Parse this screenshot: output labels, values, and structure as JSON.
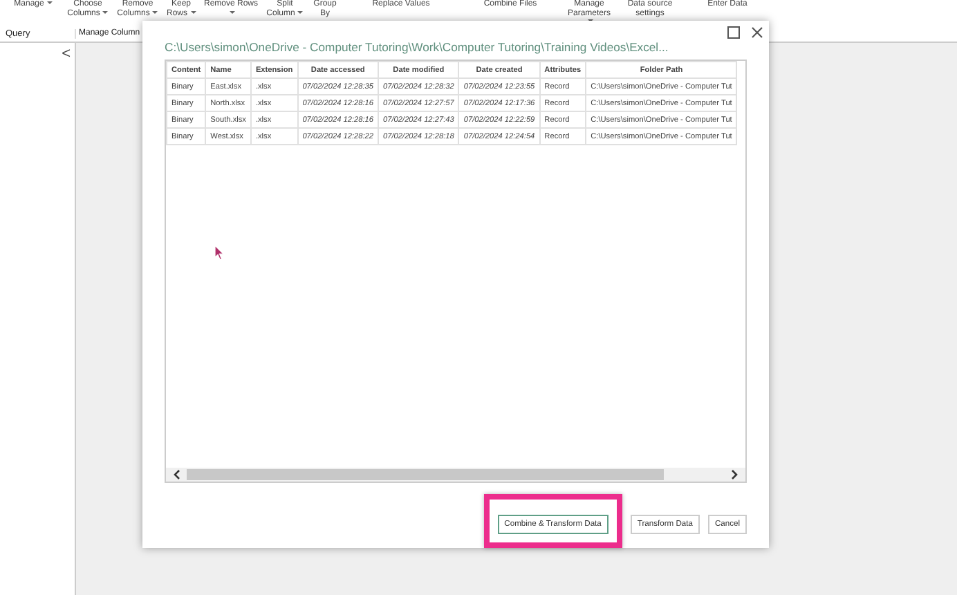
{
  "ribbon": {
    "items": [
      {
        "label": "Manage",
        "dropdown": true
      },
      {
        "label": "Choose Columns",
        "dropdown": true
      },
      {
        "label": "Remove Columns",
        "dropdown": true
      },
      {
        "label": "Keep Rows",
        "dropdown": true
      },
      {
        "label": "Remove Rows",
        "dropdown": true
      },
      {
        "label": "Split Column",
        "dropdown": true
      },
      {
        "label": "Group By",
        "dropdown": false
      },
      {
        "label": "Replace Values",
        "dropdown": false
      },
      {
        "label": "Combine Files",
        "dropdown": false
      },
      {
        "label": "Manage Parameters",
        "dropdown": true
      },
      {
        "label": "Data source settings",
        "dropdown": false
      },
      {
        "label": "Enter Data",
        "dropdown": false
      }
    ],
    "groups": [
      "Query",
      "Manage Column"
    ]
  },
  "collapse_button": "<",
  "dialog": {
    "title": "C:\\Users\\simon\\OneDrive - Computer Tutoring\\Work\\Computer Tutoring\\Training Videos\\Excel...",
    "table": {
      "columns": [
        "Content",
        "Name",
        "Extension",
        "Date accessed",
        "Date modified",
        "Date created",
        "Attributes",
        "Folder Path"
      ],
      "rows": [
        [
          "Binary",
          "East.xlsx",
          ".xlsx",
          "07/02/2024 12:28:35",
          "07/02/2024 12:28:32",
          "07/02/2024 12:23:55",
          "Record",
          "C:\\Users\\simon\\OneDrive - Computer Tut"
        ],
        [
          "Binary",
          "North.xlsx",
          ".xlsx",
          "07/02/2024 12:28:16",
          "07/02/2024 12:27:57",
          "07/02/2024 12:17:36",
          "Record",
          "C:\\Users\\simon\\OneDrive - Computer Tut"
        ],
        [
          "Binary",
          "South.xlsx",
          ".xlsx",
          "07/02/2024 12:28:16",
          "07/02/2024 12:27:43",
          "07/02/2024 12:22:59",
          "Record",
          "C:\\Users\\simon\\OneDrive - Computer Tut"
        ],
        [
          "Binary",
          "West.xlsx",
          ".xlsx",
          "07/02/2024 12:28:22",
          "07/02/2024 12:28:18",
          "07/02/2024 12:24:54",
          "Record",
          "C:\\Users\\simon\\OneDrive - Computer Tut"
        ]
      ]
    },
    "buttons": [
      {
        "label": "Combine & Transform Data",
        "highlighted": true
      },
      {
        "label": "Transform Data",
        "highlighted": false
      },
      {
        "label": "Cancel",
        "highlighted": false
      }
    ]
  }
}
